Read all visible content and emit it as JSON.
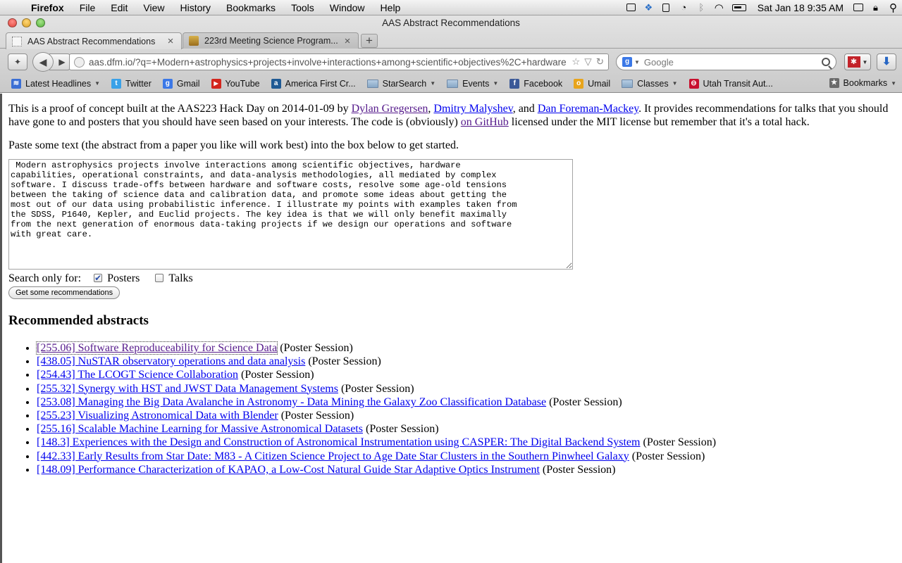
{
  "menubar": {
    "apple": "",
    "app": "Firefox",
    "items": [
      "File",
      "Edit",
      "View",
      "History",
      "Bookmarks",
      "Tools",
      "Window",
      "Help"
    ],
    "clock": "Sat Jan 18  9:35 AM"
  },
  "window": {
    "title": "AAS Abstract Recommendations"
  },
  "tabs": [
    {
      "label": "AAS Abstract Recommendations",
      "close": "×"
    },
    {
      "label": "223rd Meeting Science Program...",
      "close": "×"
    }
  ],
  "tab_new": "+",
  "nav": {
    "back": "◀",
    "forward": "▶",
    "url": "aas.dfm.io/?q=+Modern+astrophysics+projects+involve+interactions+among+scientific+objectives%2C+hardware",
    "star": "☆",
    "dropdown": "▽",
    "reload": "↻",
    "search_placeholder": "Google",
    "search_logo": "g",
    "addon": "✱",
    "download": "⬇"
  },
  "bookmarks": {
    "items": [
      {
        "label": "Latest Headlines",
        "icon": "rss-icon",
        "icon_color": "#3b6fd4",
        "icon_text": "≋",
        "caret": "▼"
      },
      {
        "label": "Twitter",
        "icon": "twitter-icon",
        "icon_color": "#3aa1e8",
        "icon_text": "t"
      },
      {
        "label": "Gmail",
        "icon": "google-icon",
        "icon_color": "#3b78e7",
        "icon_text": "g"
      },
      {
        "label": "YouTube",
        "icon": "youtube-icon",
        "icon_color": "#d3261d",
        "icon_text": "▶"
      },
      {
        "label": "America First Cr...",
        "icon": "bank-icon",
        "icon_color": "#1f5a94",
        "icon_text": "a"
      },
      {
        "label": "StarSearch",
        "icon": "folder-icon",
        "caret": "▼"
      },
      {
        "label": "Events",
        "icon": "folder-icon",
        "caret": "▼"
      },
      {
        "label": "Facebook",
        "icon": "facebook-icon",
        "icon_color": "#3b5998",
        "icon_text": "f"
      },
      {
        "label": "Umail",
        "icon": "mail-icon",
        "icon_color": "#e8a41b",
        "icon_text": "o"
      },
      {
        "label": "Classes",
        "icon": "folder-icon",
        "caret": "▼"
      },
      {
        "label": "Utah Transit Aut...",
        "icon": "uta-icon",
        "icon_color": "#c8102e",
        "icon_text": "⊖"
      }
    ],
    "right_label": "Bookmarks"
  },
  "page": {
    "intro": {
      "before": "This is a proof of concept built at the AAS223 Hack Day on 2014-01-09 by ",
      "author1": "Dylan Gregersen",
      "sep1": ", ",
      "author2": "Dmitry Malyshev",
      "sep2": ", and ",
      "author3": "Dan Foreman-Mackey",
      "mid": ". It provides recommendations for talks that you should have gone to and posters that you should have seen based on your interests. The code is (obviously) ",
      "github": "on GitHub",
      "after": " licensed under the MIT license but remember that it's a total hack."
    },
    "prompt": "Paste some text (the abstract from a paper you like will work best) into the box below to get started.",
    "abstract_text": " Modern astrophysics projects involve interactions among scientific objectives, hardware\ncapabilities, operational constraints, and data-analysis methodologies, all mediated by complex\nsoftware. I discuss trade-offs between hardware and software costs, resolve some age-old tensions\nbetween the taking of science data and calibration data, and promote some ideas about getting the\nmost out of our data using probabilistic inference. I illustrate my points with examples taken from\nthe SDSS, P1640, Kepler, and Euclid projects. The key idea is that we will only benefit maximally\nfrom the next generation of enormous data-taking projects if we design our operations and software\nwith great care.",
    "filters": {
      "label": "Search only for:",
      "posters": {
        "label": "Posters",
        "checked": true
      },
      "talks": {
        "label": "Talks",
        "checked": false
      }
    },
    "submit": "Get some recommendations",
    "results_heading": "Recommended abstracts",
    "results": [
      {
        "title": "[255.06] Software Reproduceability for Science Data",
        "session": "(Poster Session)"
      },
      {
        "title": "[438.05] NuSTAR observatory operations and data analysis",
        "session": "(Poster Session)"
      },
      {
        "title": "[254.43] The LCOGT Science Collaboration",
        "session": "(Poster Session)"
      },
      {
        "title": "[255.32] Synergy with HST and JWST Data Management Systems",
        "session": "(Poster Session)"
      },
      {
        "title": "[253.08] Managing the Big Data Avalanche in Astronomy - Data Mining the Galaxy Zoo Classification Database",
        "session": "(Poster Session)"
      },
      {
        "title": "[255.23] Visualizing Astronomical Data with Blender",
        "session": "(Poster Session)"
      },
      {
        "title": "[255.16] Scalable Machine Learning for Massive Astronomical Datasets",
        "session": "(Poster Session)"
      },
      {
        "title": "[148.3] Experiences with the Design and Construction of Astronomical Instrumentation using CASPER: The Digital Backend System",
        "session": "(Poster Session)"
      },
      {
        "title": "[442.33] Early Results from Star Date: M83 - A Citizen Science Project to Age Date Star Clusters in the Southern Pinwheel Galaxy",
        "session": "(Poster Session)"
      },
      {
        "title": "[148.09] Performance Characterization of KAPAO, a Low-Cost Natural Guide Star Adaptive Optics Instrument",
        "session": "(Poster Session)"
      }
    ]
  }
}
